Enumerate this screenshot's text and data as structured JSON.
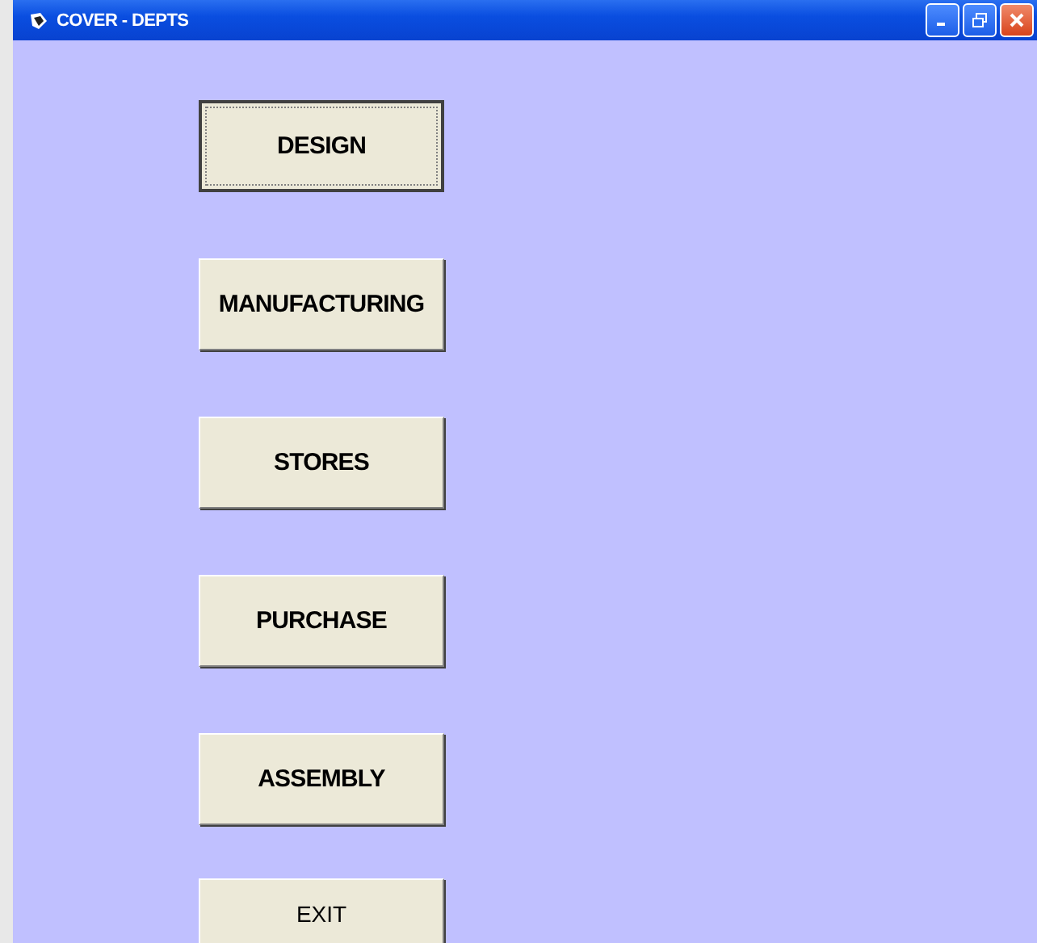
{
  "window": {
    "title": "COVER - DEPTS"
  },
  "buttons": [
    {
      "label": "DESIGN",
      "kind": "dept",
      "focused": true
    },
    {
      "label": "MANUFACTURING",
      "kind": "dept",
      "focused": false
    },
    {
      "label": "STORES",
      "kind": "dept",
      "focused": false
    },
    {
      "label": "PURCHASE",
      "kind": "dept",
      "focused": false
    },
    {
      "label": "ASSEMBLY",
      "kind": "dept",
      "focused": false
    },
    {
      "label": "EXIT",
      "kind": "plain",
      "focused": false
    }
  ]
}
